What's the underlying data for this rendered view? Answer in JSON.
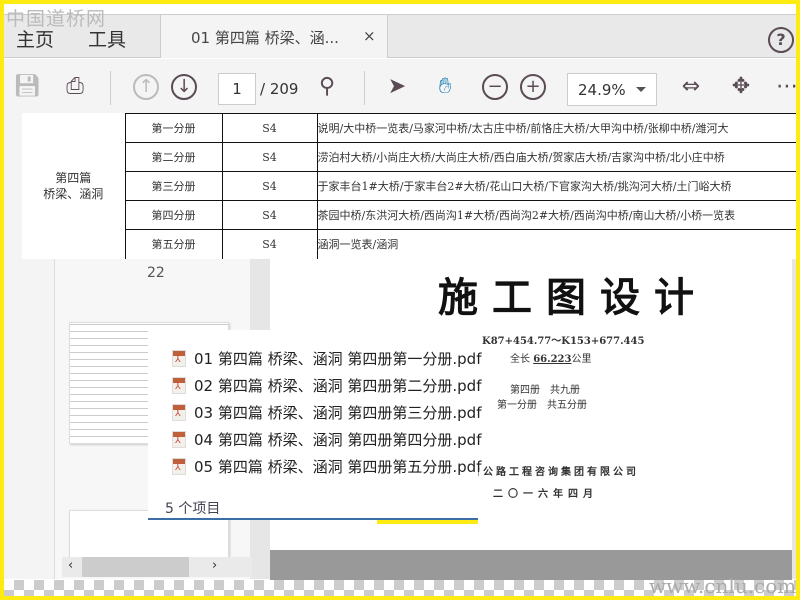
{
  "watermark": "中国道桥网",
  "watermark_bottom": "www.cnlu.com",
  "tabs": {
    "home": "主页",
    "tools": "工具",
    "document": "01 第四篇 桥梁、涵...",
    "close": "×",
    "help": "?"
  },
  "toolbar": {
    "page_current": "1",
    "page_total": "/ 209",
    "zoom": "24.9%"
  },
  "table": {
    "group": "第四篇\n桥梁、涵洞",
    "rows": [
      {
        "volume": "第一分册",
        "code": "S4",
        "content": "说明/大中桥一览表/马家河中桥/太古庄中桥/前恪庄大桥/大甲沟中桥/张柳中桥/潍河大"
      },
      {
        "volume": "第二分册",
        "code": "S4",
        "content": "涝泊村大桥/小尚庄大桥/大尚庄大桥/西白庙大桥/贺家店大桥/吉家沟中桥/北小庄中桥"
      },
      {
        "volume": "第三分册",
        "code": "S4",
        "content": "于家丰台1#大桥/于家丰台2#大桥/花山口大桥/下官家沟大桥/挑沟河大桥/土门峪大桥"
      },
      {
        "volume": "第四分册",
        "code": "S4",
        "content": "茶园中桥/东洪河大桥/西尚沟1#大桥/西尚沟2#大桥/西尚沟中桥/南山大桥/小桥一览表"
      },
      {
        "volume": "第五分册",
        "code": "S4",
        "content": "涵洞一览表/涵洞"
      }
    ]
  },
  "thumbnail_page": "22",
  "files": [
    "01 第四篇 桥梁、涵洞 第四册第一分册.pdf",
    "02 第四篇 桥梁、涵洞 第四册第二分册.pdf",
    "03 第四篇 桥梁、涵洞 第四册第三分册.pdf",
    "04 第四篇 桥梁、涵洞 第四册第四分册.pdf",
    "05 第四篇 桥梁、涵洞 第四册第五分册.pdf"
  ],
  "file_count": "5 个项目",
  "cover": {
    "title": "施工图设计",
    "range": "K87+454.77～K153+677.445",
    "length_label": "全长",
    "length": "66.223",
    "length_unit": "公里",
    "volume": "第四册　共九册",
    "part": "第一分册　共五分册",
    "company": "省公路工程咨询集团有限公司",
    "date": "二〇一六年四月"
  }
}
